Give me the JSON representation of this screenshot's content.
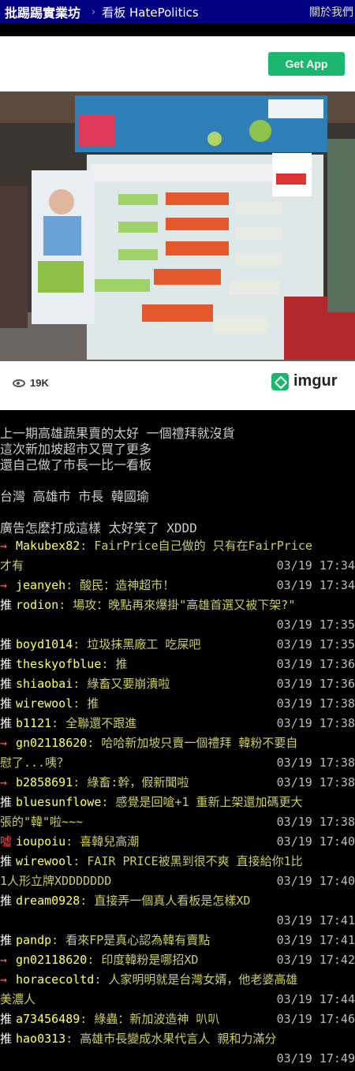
{
  "topbar": {
    "site": "批踢踢實業坊",
    "separator": "›",
    "board_label": "看板 HatePolitics",
    "about": "關於我們"
  },
  "embed": {
    "get_app": "Get App",
    "views": "19K",
    "brand": "imgur",
    "photo_description_icon": "supermarket-photo"
  },
  "content": [
    "上一期高雄蔬果賣的太好 一個禮拜就沒貨",
    "這次新加坡超市又買了更多",
    "還自己做了市長一比一看板",
    "",
    "台灣 高雄市 市長 韓國瑜",
    "",
    "廣告怎麼打成這樣 太好笑了 XDDD"
  ],
  "pushes": [
    {
      "tag": "→",
      "type": "arrow",
      "user": "Makubex82",
      "msg": "FairPrice自己做的 只有在FairPrice",
      "cont": "才有",
      "time": "03/19 17:34"
    },
    {
      "tag": "→",
      "type": "arrow",
      "user": "jeanyeh",
      "msg": "酸民：造神超市！",
      "time": "03/19 17:34"
    },
    {
      "tag": "推",
      "type": "good",
      "user": "rodion",
      "msg": "場攻：晚點再來爆掛\"高雄首選又被下架?\"",
      "cont": "",
      "time": "03/19 17:35"
    },
    {
      "tag": "推",
      "type": "good",
      "user": "boyd1014",
      "msg": "垃圾抹黑廠工 吃屎吧",
      "time": "03/19 17:35"
    },
    {
      "tag": "推",
      "type": "good",
      "user": "theskyofblue",
      "msg": "推",
      "time": "03/19 17:36"
    },
    {
      "tag": "推",
      "type": "good",
      "user": "shiaobai",
      "msg": "綠畜又要崩潰啦",
      "time": "03/19 17:36"
    },
    {
      "tag": "推",
      "type": "good",
      "user": "wirewool",
      "msg": "推",
      "time": "03/19 17:38"
    },
    {
      "tag": "推",
      "type": "good",
      "user": "b1121",
      "msg": "全聯還不跟進",
      "time": "03/19 17:38"
    },
    {
      "tag": "→",
      "type": "arrow",
      "user": "gn02118620",
      "msg": "哈哈新加坡只賣一個禮拜 韓粉不要自",
      "cont": "慰了...咦？",
      "time": "03/19 17:38"
    },
    {
      "tag": "→",
      "type": "arrow",
      "user": "b2858691",
      "msg": "綠畜:幹，假新聞啦",
      "time": "03/19 17:38"
    },
    {
      "tag": "推",
      "type": "good",
      "user": "bluesunflowe",
      "msg": "感覺是回嗆+1 重新上架還加碼更大",
      "cont": "張的\"韓\"啦~~~",
      "time": "03/19 17:38"
    },
    {
      "tag": "噓",
      "type": "boo",
      "user": "ioupoiu",
      "msg": "喜韓兒高潮",
      "time": "03/19 17:40"
    },
    {
      "tag": "推",
      "type": "good",
      "user": "wirewool",
      "msg": "FAIR PRICE被黑到很不爽 直接給你1比",
      "cont": "1人形立牌XDDDDDDD",
      "time": "03/19 17:40"
    },
    {
      "tag": "推",
      "type": "good",
      "user": "dream0928",
      "msg": "直接弄一個真人看板是怎樣XD",
      "cont": "",
      "time": "03/19 17:41"
    },
    {
      "tag": "推",
      "type": "good",
      "user": "pandp",
      "msg": "看來FP是真心認為韓有賣點",
      "time": "03/19 17:41"
    },
    {
      "tag": "→",
      "type": "arrow",
      "user": "gn02118620",
      "msg": "印度韓粉是哪招XD",
      "time": "03/19 17:42"
    },
    {
      "tag": "→",
      "type": "arrow",
      "user": "horacecoltd",
      "msg": "人家明明就是台灣女婿，他老婆高雄",
      "cont": "美濃人",
      "time": "03/19 17:44"
    },
    {
      "tag": "推",
      "type": "good",
      "user": "a73456489",
      "msg": "綠蟲：新加波造神 叭叭",
      "time": "03/19 17:46"
    },
    {
      "tag": "推",
      "type": "good",
      "user": "hao0313",
      "msg": "高雄市長變成水果代言人 親和力滿分",
      "cont": "",
      "time": "03/19 17:49"
    }
  ]
}
